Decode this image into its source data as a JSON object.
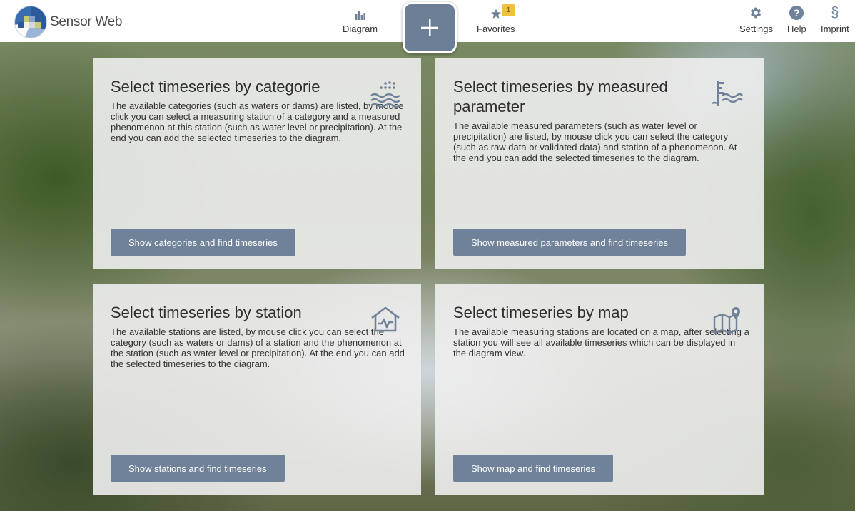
{
  "brand": {
    "name": "Sensor Web"
  },
  "nav": {
    "diagram": "Diagram",
    "favorites": "Favorites",
    "favorites_count": "1",
    "settings": "Settings",
    "help": "Help",
    "imprint": "Imprint"
  },
  "cards": [
    {
      "title": "Select timeseries by categorie",
      "text": "The available categories (such as waters or dams) are listed, by mouse click you can select a measuring station of a category and a measured phenomenon at this station (such as water level or precipitation). At the end you can add the selected timeseries to the diagram.",
      "button": "Show categories and find timeseries",
      "icon": "rain-waves-icon"
    },
    {
      "title": "Select timeseries by measured parameter",
      "text": "The available measured parameters (such as water level or precipitation) are listed, by mouse click you can select the category (such as raw data or validated data) and station of a phenomenon. At the end you can add the selected timeseries to the diagram.",
      "button": "Show measured parameters and find timeseries",
      "icon": "water-gauge-icon"
    },
    {
      "title": "Select timeseries by station",
      "text": "The available stations are listed, by mouse click you can select the category (such as waters or dams) of a station and the phenomenon at the station (such as water level or precipitation). At the end you can add the selected timeseries to the diagram.",
      "button": "Show stations and find timeseries",
      "icon": "station-house-icon"
    },
    {
      "title": "Select timeseries by map",
      "text": "The available measuring stations are located on a map, after selecting a station you will see all available timeseries which can be displayed in the diagram view.",
      "button": "Show map and find timeseries",
      "icon": "map-pin-icon"
    }
  ],
  "colors": {
    "accent": "#6f8299",
    "header_bg": "#ffffff",
    "badge": "#f0c040",
    "card_bg": "#eeeeee"
  }
}
